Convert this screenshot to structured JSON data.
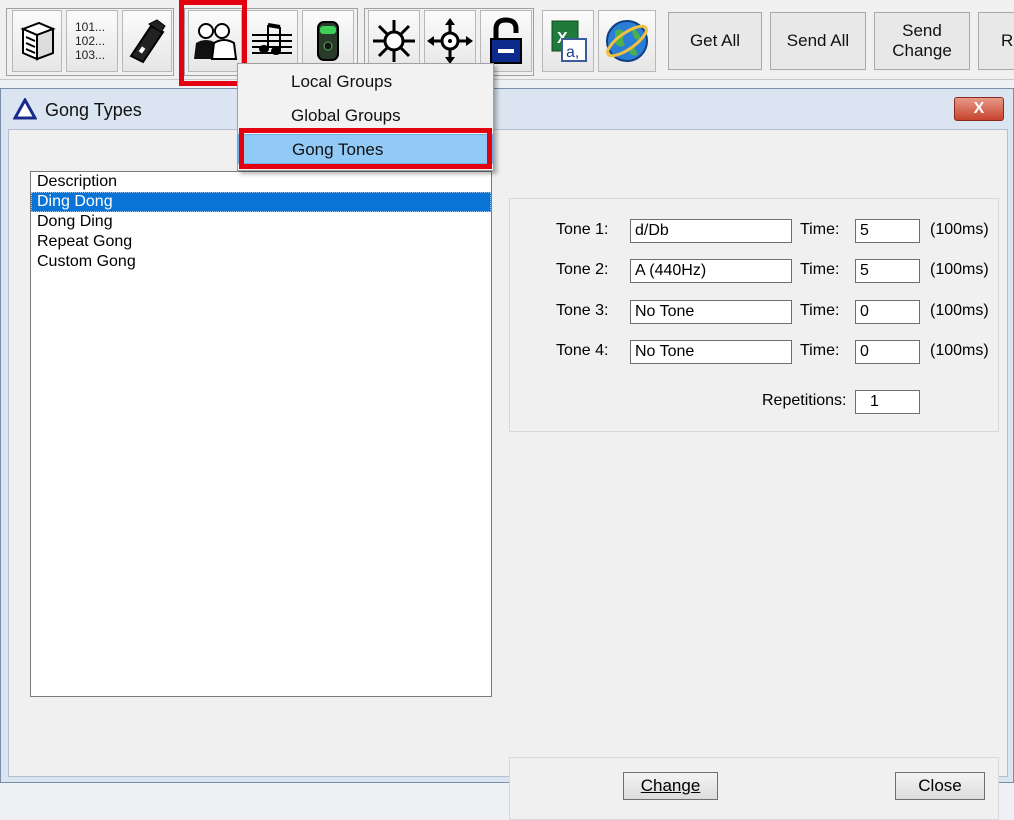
{
  "toolbar": {
    "code_lines": [
      "101...",
      "102...",
      "103..."
    ],
    "icons": [
      "server-icon",
      "codes-icon",
      "phone-icon",
      "groups-icon",
      "music-icon",
      "device-icon",
      "move-all-icon",
      "move-icon",
      "lock-icon",
      "excel-icon",
      "globe-icon"
    ],
    "get_all": "Get All",
    "send_all": "Send All",
    "send_change_line1": "Send",
    "send_change_line2": "Change",
    "partial_button": "R"
  },
  "menu": {
    "items": [
      {
        "label": "Local Groups"
      },
      {
        "label": "Global Groups"
      },
      {
        "label": "Gong Tones"
      }
    ]
  },
  "dialog": {
    "title": "Gong Types",
    "close_glyph": "X",
    "list": {
      "header": "Description",
      "items": [
        "Ding Dong",
        "Dong Ding",
        "Repeat Gong",
        "Custom Gong"
      ],
      "selected_index": 0
    },
    "tones": [
      {
        "label": "Tone 1:",
        "value": "d/Db",
        "time_label": "Time:",
        "time": "5",
        "unit": "(100ms)"
      },
      {
        "label": "Tone 2:",
        "value": "A (440Hz)",
        "time_label": "Time:",
        "time": "5",
        "unit": "(100ms)"
      },
      {
        "label": "Tone 3:",
        "value": "No Tone",
        "time_label": "Time:",
        "time": "0",
        "unit": "(100ms)"
      },
      {
        "label": "Tone 4:",
        "value": "No Tone",
        "time_label": "Time:",
        "time": "0",
        "unit": "(100ms)"
      }
    ],
    "repetitions_label": "Repetitions:",
    "repetitions": "1",
    "change_button": "Change",
    "close_button": "Close"
  },
  "colors": {
    "highlight_red": "#e4000f",
    "selection_blue": "#0a74d6",
    "menu_hover": "#91c9f7"
  }
}
